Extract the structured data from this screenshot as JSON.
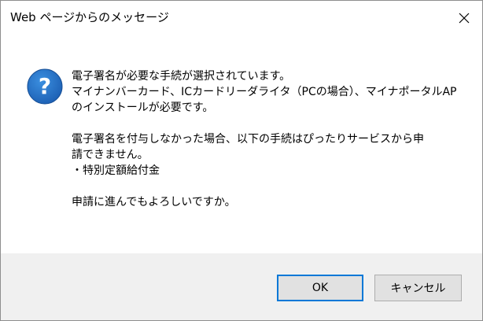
{
  "window": {
    "title": "Web ページからのメッセージ",
    "close_icon": "close-icon"
  },
  "message": {
    "icon": "question-icon",
    "icon_color": "#1e6fc9",
    "paragraphs": [
      {
        "lines": [
          "電子署名が必要な手続が選択されています。",
          "マイナンバーカード、ICカードリーダライタ（PCの場合）、マイナポータルAP",
          "のインストールが必要です。"
        ]
      },
      {
        "lines": [
          "電子署名を付与しなかった場合、以下の手続はぴったりサービスから申",
          "請できません。",
          "・特別定額給付金"
        ]
      },
      {
        "lines": [
          "申請に進んでもよろしいですか。"
        ]
      }
    ]
  },
  "buttons": {
    "ok_label": "OK",
    "cancel_label": "キャンセル",
    "ok_border_color": "#0078d7"
  }
}
